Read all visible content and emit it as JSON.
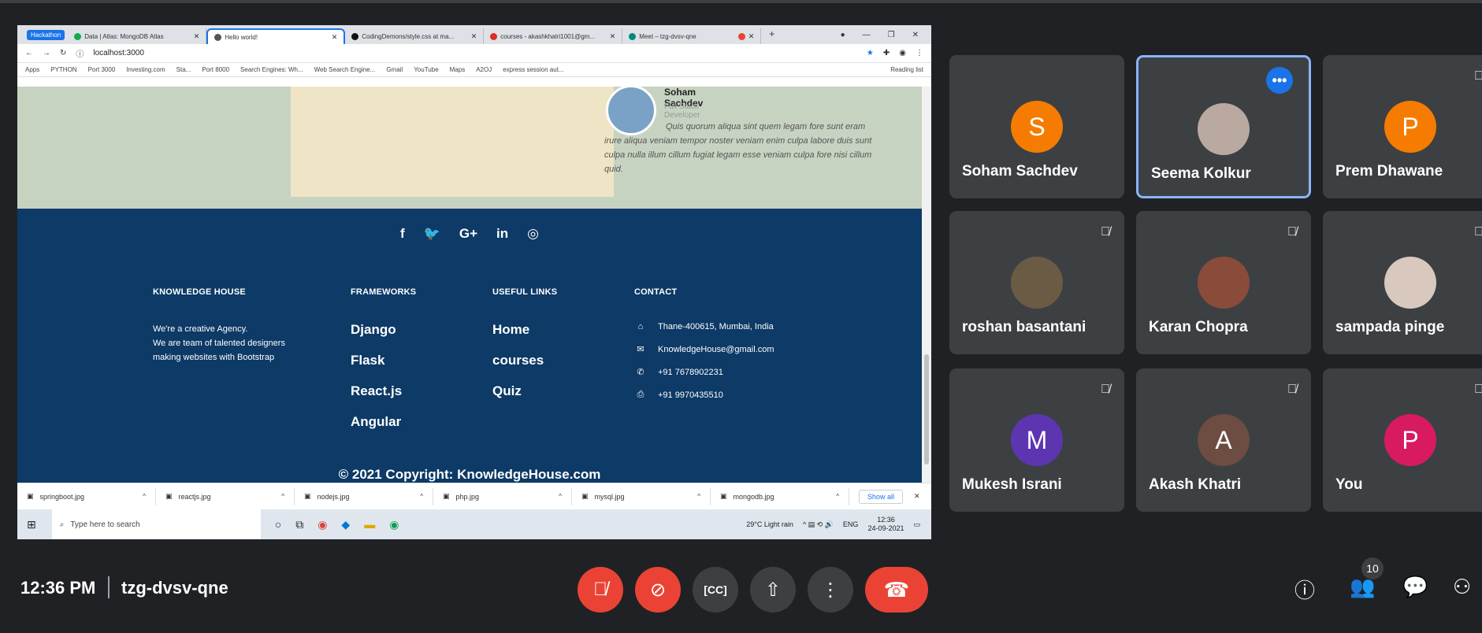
{
  "browser": {
    "tab_group": "Hackathon",
    "tabs": [
      {
        "title": "Data | Atlas: MongoDB Atlas",
        "active": false
      },
      {
        "title": "Hello world!",
        "active": true
      },
      {
        "title": "CodingDemons/style.css at ma...",
        "active": false
      },
      {
        "title": "courses - akashkhatri1001@gm...",
        "active": false
      },
      {
        "title": "Meet – tzg-dvsv-qne",
        "active": false
      }
    ],
    "url": "localhost:3000",
    "bookmarks": [
      "Apps",
      "PYTHON",
      "Port 3000",
      "Investing.com",
      "Sta...",
      "Port 8000",
      "Search Engines: Wh...",
      "Web Search Engine...",
      "Gmail",
      "YouTube",
      "Maps",
      "A2OJ",
      "express session aut..."
    ],
    "reading_list": "Reading list"
  },
  "testimonial": {
    "name": "Soham Sachdev",
    "role": "Full Stack Developer",
    "quote": "Quis quorum aliqua sint quem legam fore sunt eram irure aliqua veniam tempor noster veniam enim culpa labore duis sunt culpa nulla illum cillum fugiat legam esse veniam culpa fore nisi cillum quid."
  },
  "footer": {
    "social_icons": [
      "f",
      "🐦",
      "G+",
      "in",
      "◎"
    ],
    "brand_heading": "KNOWLEDGE HOUSE",
    "about_lines": [
      "We're a creative Agency.",
      "We are team of talented designers",
      "making websites with Bootstrap"
    ],
    "frameworks_heading": "FRAMEWORKS",
    "frameworks": [
      "Django",
      "Flask",
      "React.js",
      "Angular"
    ],
    "links_heading": "USEFUL LINKS",
    "links": [
      "Home",
      "courses",
      "Quiz"
    ],
    "contact_heading": "CONTACT",
    "contact": [
      {
        "icon": "home-icon",
        "glyph": "⌂",
        "text": "Thane-400615, Mumbai, India"
      },
      {
        "icon": "mail-icon",
        "glyph": "✉",
        "text": "KnowledgeHouse@gmail.com"
      },
      {
        "icon": "phone-icon",
        "glyph": "✆",
        "text": "+91 7678902231"
      },
      {
        "icon": "print-icon",
        "glyph": "⎙",
        "text": "+91 9970435510"
      }
    ],
    "copyright": "© 2021 Copyright: KnowledgeHouse.com"
  },
  "downloads": {
    "files": [
      "springboot.jpg",
      "reactjs.jpg",
      "nodejs.jpg",
      "php.jpg",
      "mysql.jpg",
      "mongodb.jpg"
    ],
    "show_all": "Show all"
  },
  "taskbar": {
    "search_placeholder": "Type here to search",
    "weather": "29°C Light rain",
    "lang": "ENG",
    "time": "12:36",
    "date": "24-09-2021"
  },
  "participants": [
    {
      "name": "Soham Sachdev",
      "initial": "S",
      "color": "#f57c00",
      "muted": false,
      "type": "initial"
    },
    {
      "name": "Seema Kolkur",
      "initial": "",
      "color": "#b9a9a0",
      "muted": false,
      "type": "photo",
      "speaking": true
    },
    {
      "name": "Prem Dhawane",
      "initial": "P",
      "color": "#f57c00",
      "muted": true,
      "type": "initial"
    },
    {
      "name": "roshan basantani",
      "initial": "",
      "color": "#6b5b45",
      "muted": true,
      "type": "photo"
    },
    {
      "name": "Karan Chopra",
      "initial": "",
      "color": "#8a4b3b",
      "muted": true,
      "type": "photo"
    },
    {
      "name": "sampada pinge",
      "initial": "",
      "color": "#d8c8be",
      "muted": true,
      "type": "photo"
    },
    {
      "name": "Mukesh Israni",
      "initial": "M",
      "color": "#5e35b1",
      "muted": true,
      "type": "initial"
    },
    {
      "name": "Akash Khatri",
      "initial": "A",
      "color": "#6d4c41",
      "muted": true,
      "type": "initial"
    },
    {
      "name": "You",
      "initial": "P",
      "color": "#d81b60",
      "muted": true,
      "type": "initial"
    }
  ],
  "meeting": {
    "time": "12:36 PM",
    "code": "tzg-dvsv-qne",
    "participant_count": "10"
  }
}
